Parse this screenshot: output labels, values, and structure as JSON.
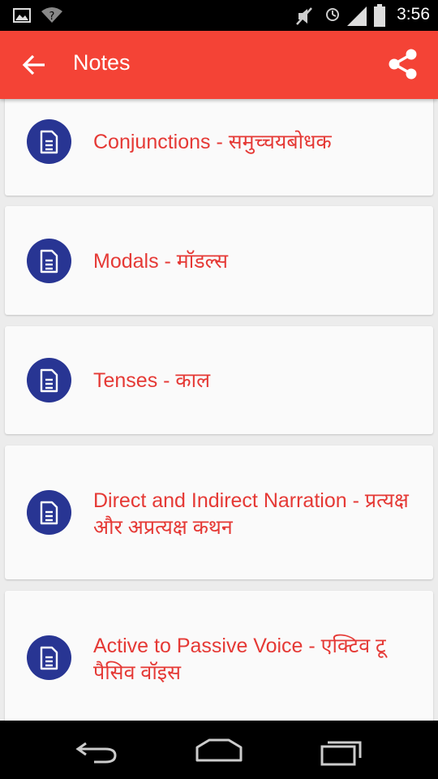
{
  "status_bar": {
    "time": "3:56",
    "icons": [
      "image-icon",
      "wifi-question-icon",
      "mute-icon",
      "alarm-icon",
      "signal-icon",
      "battery-icon"
    ]
  },
  "app_bar": {
    "title": "Notes",
    "background": "#f44336",
    "back_icon": "arrow-left-icon",
    "share_icon": "share-icon"
  },
  "notes": [
    {
      "title": "Conjunctions - समुच्चयबोधक"
    },
    {
      "title": "Modals - मॉडल्स"
    },
    {
      "title": "Tenses - काल"
    },
    {
      "title": "Direct and Indirect Narration - प्रत्यक्ष और अप्रत्यक्ष कथन"
    },
    {
      "title": "Active to Passive Voice - एक्टिव टू पैसिव वॉइस"
    }
  ],
  "theme": {
    "accent": "#f44336",
    "icon_circle": "#283593",
    "label_color": "#e53935"
  },
  "nav_bar": {
    "icons": [
      "back-icon",
      "home-icon",
      "recents-icon"
    ]
  }
}
